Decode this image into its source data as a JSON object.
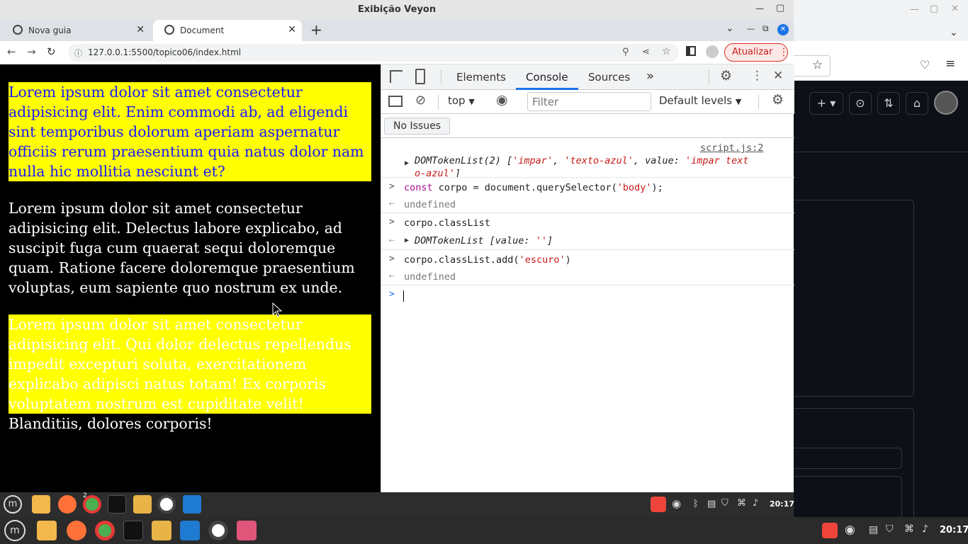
{
  "window": {
    "title": "Exibição Veyon",
    "tabs": [
      {
        "label": "Nova guia",
        "close": "✕"
      },
      {
        "label": "Document",
        "close": "✕"
      }
    ],
    "new_tab": "+",
    "url": "127.0.0.1:5500/topico06/index.html",
    "update_button": "Atualizar"
  },
  "page": {
    "paragraphs": [
      {
        "text": "Lorem ipsum dolor sit amet consectetur adipisicing elit. Enim commodi ab, ad eligendi sint temporibus dolorum aperiam aspernatur officiis rerum praesentium quia natus dolor nam nulla hic mollitia nesciunt et?",
        "bg": "#ffff00",
        "color": "#1a1aff"
      },
      {
        "text": "Lorem ipsum dolor sit amet consectetur adipisicing elit. Delectus labore explicabo, ad suscipit fuga cum quaerat sequi doloremque quam. Ratione facere doloremque praesentium voluptas, eum sapiente quo nostrum ex unde.",
        "bg": "#000000",
        "color": "#ffffff"
      },
      {
        "text": "Lorem ipsum dolor sit amet consectetur adipisicing elit. Qui dolor delectus repellendus impedit excepturi soluta, exercitationem explicabo adipisci natus totam! Ex corporis voluptatem nostrum est cupiditate velit! Blanditiis, dolores corporis!",
        "bg": "#ffff00",
        "color": "#ffffff"
      }
    ]
  },
  "devtools": {
    "tabs": [
      "Elements",
      "Console",
      "Sources"
    ],
    "more": "»",
    "context": "top",
    "filter_placeholder": "Filter",
    "levels": "Default levels",
    "issues": "No Issues",
    "console": {
      "source_link": "script.js:2",
      "log1_prefix": "DOMTokenList(2) [",
      "log1_s1": "'impar'",
      "log1_comma": ", ",
      "log1_s2": "'texto-azul'",
      "log1_value_key": ", value: ",
      "log1_s3a": "'impar text",
      "log1_s3b": "o-azul'",
      "log1_end": "]",
      "cmd1_kw": "const",
      "cmd1_rest": " corpo = document.querySelector(",
      "cmd1_str": "'body'",
      "cmd1_end": ");",
      "ret1": "undefined",
      "cmd2": "corpo.classList",
      "ret2_prefix": "DOMTokenList [value: ",
      "ret2_str": "''",
      "ret2_end": "]",
      "cmd3_pre": "corpo.classList.add(",
      "cmd3_str": "'escuro'",
      "cmd3_end": ")",
      "ret3": "undefined"
    }
  },
  "taskbar": {
    "time_inner": "20:17",
    "time_outer": "20:17",
    "badge": "2"
  },
  "colors": {
    "accent": "#1a73e8",
    "yellow": "#ffff00",
    "update_red": "#c5221f"
  }
}
